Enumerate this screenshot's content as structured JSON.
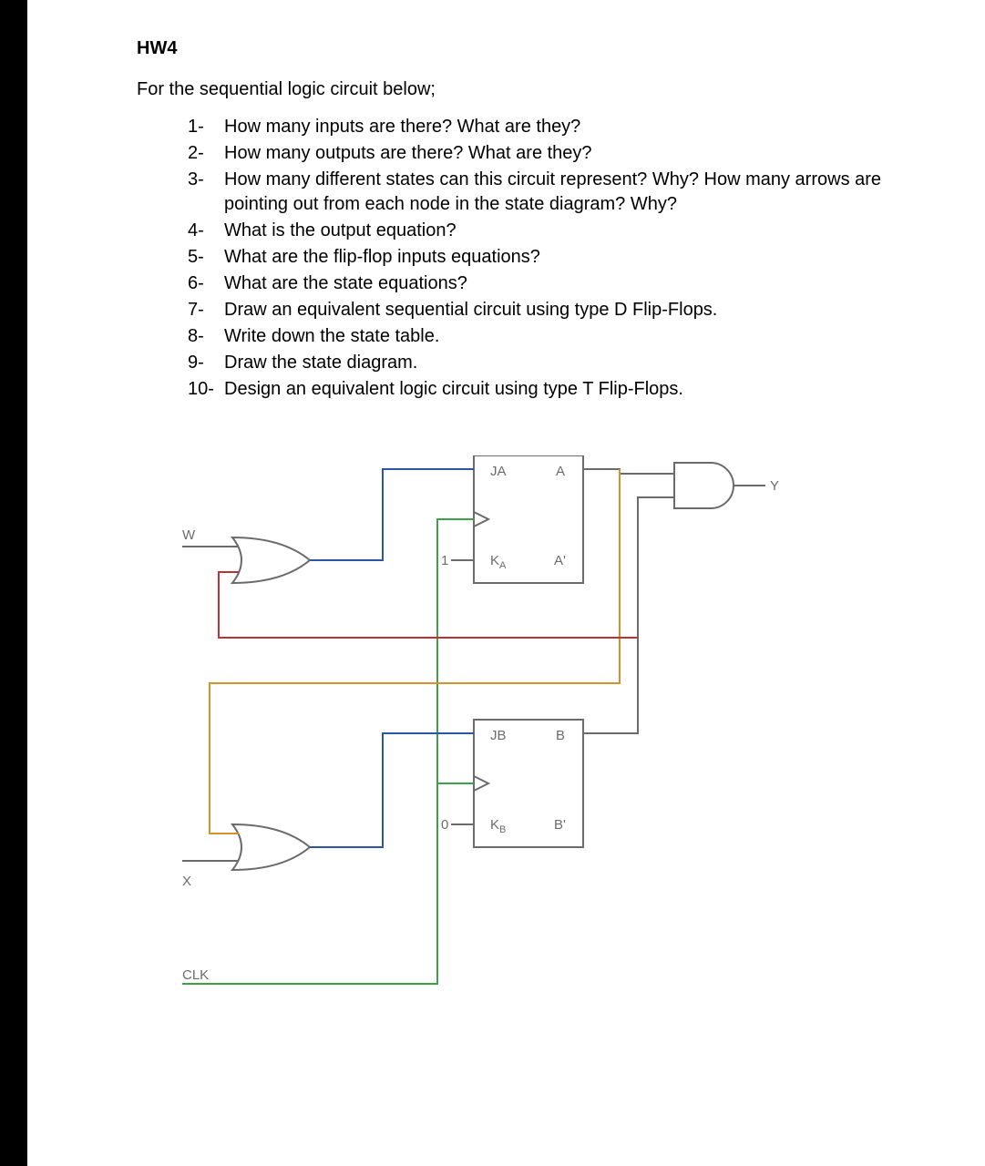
{
  "title": "HW4",
  "intro": "For the sequential logic circuit below;",
  "questions": [
    {
      "n": "1-",
      "t": "How many inputs are there? What are they?"
    },
    {
      "n": "2-",
      "t": "How many outputs are there? What are they?"
    },
    {
      "n": "3-",
      "t": "How many different states can this circuit represent? Why? How many arrows are pointing out from each node in the state diagram? Why?"
    },
    {
      "n": "4-",
      "t": "What is the output equation?"
    },
    {
      "n": "5-",
      "t": "What are the flip-flop inputs equations?"
    },
    {
      "n": "6-",
      "t": "What are the state equations?"
    },
    {
      "n": "7-",
      "t": "Draw an equivalent sequential circuit using type D Flip-Flops."
    },
    {
      "n": "8-",
      "t": "Write down the state table."
    },
    {
      "n": "9-",
      "t": "Draw the state diagram."
    },
    {
      "n": "10-",
      "t": "Design an equivalent logic circuit using type T Flip-Flops."
    }
  ],
  "circuit": {
    "inputs": {
      "w": "W",
      "x": "X",
      "clk": "CLK"
    },
    "output": "Y",
    "const1": "1",
    "const0": "0",
    "ffA": {
      "ja": "JA",
      "ka": "K",
      "kas": "A",
      "q": "A",
      "qn": "A'"
    },
    "ffB": {
      "jb": "JB",
      "kb": "K",
      "kbs": "B",
      "q": "B",
      "qn": "B'"
    }
  }
}
